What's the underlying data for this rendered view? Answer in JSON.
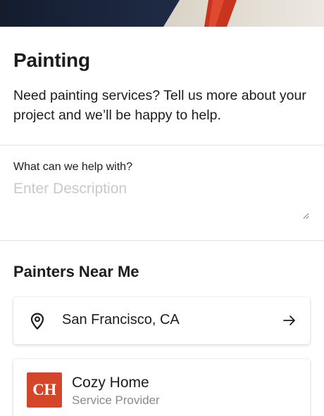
{
  "service": {
    "title": "Painting",
    "intro": "Need painting services? Tell us more about your project and we’ll be happy to help."
  },
  "request": {
    "label": "What can we help with?",
    "placeholder": "Enter Description",
    "value": ""
  },
  "nearby": {
    "title": "Painters Near Me",
    "location": "San Francisco, CA",
    "location_icon": "map-pin-icon",
    "go_icon": "arrow-right-icon"
  },
  "providers": [
    {
      "logo_text": "CH",
      "logo_color": "#d4462a",
      "name": "Cozy Home",
      "type": "Service Provider"
    }
  ],
  "colors": {
    "text": "#1c1c1c",
    "muted": "#8a8a8a",
    "placeholder": "#c9c9c9",
    "divider": "#e2e2e2"
  }
}
